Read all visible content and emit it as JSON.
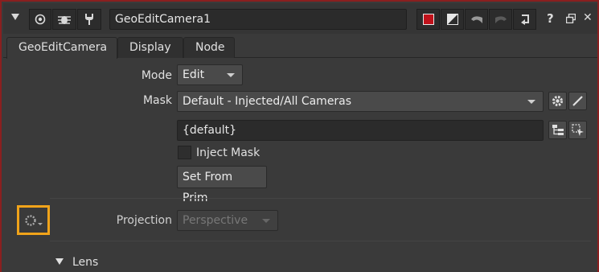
{
  "window": {
    "node_name": "GeoEditCamera1",
    "border_color": "#8a1f1f",
    "icons": [
      "collapse-arrow-icon",
      "viewer-eye-icon",
      "bug-icon",
      "wrench-icon",
      "color-swatch-icon",
      "bypass-icon",
      "undo-icon",
      "redo-icon",
      "revert-icon",
      "help-icon",
      "float-window-icon",
      "close-icon"
    ],
    "help_label": "?",
    "close_label": "✕"
  },
  "tabs": [
    {
      "label": "GeoEditCamera",
      "active": true
    },
    {
      "label": "Display",
      "active": false
    },
    {
      "label": "Node",
      "active": false
    }
  ],
  "params": {
    "mode": {
      "label": "Mode",
      "value": "Edit"
    },
    "mask": {
      "label": "Mask",
      "value": "Default - Injected/All Cameras",
      "expression": "{default}"
    },
    "inject_mask": {
      "label": "Inject Mask",
      "checked": false
    },
    "set_from_prim": {
      "label": "Set From Prim"
    },
    "projection": {
      "label": "Projection",
      "value": "Perspective",
      "enabled": false
    },
    "lens": {
      "label": "Lens",
      "expanded": true
    }
  },
  "highlight_color": "#f0a31a"
}
